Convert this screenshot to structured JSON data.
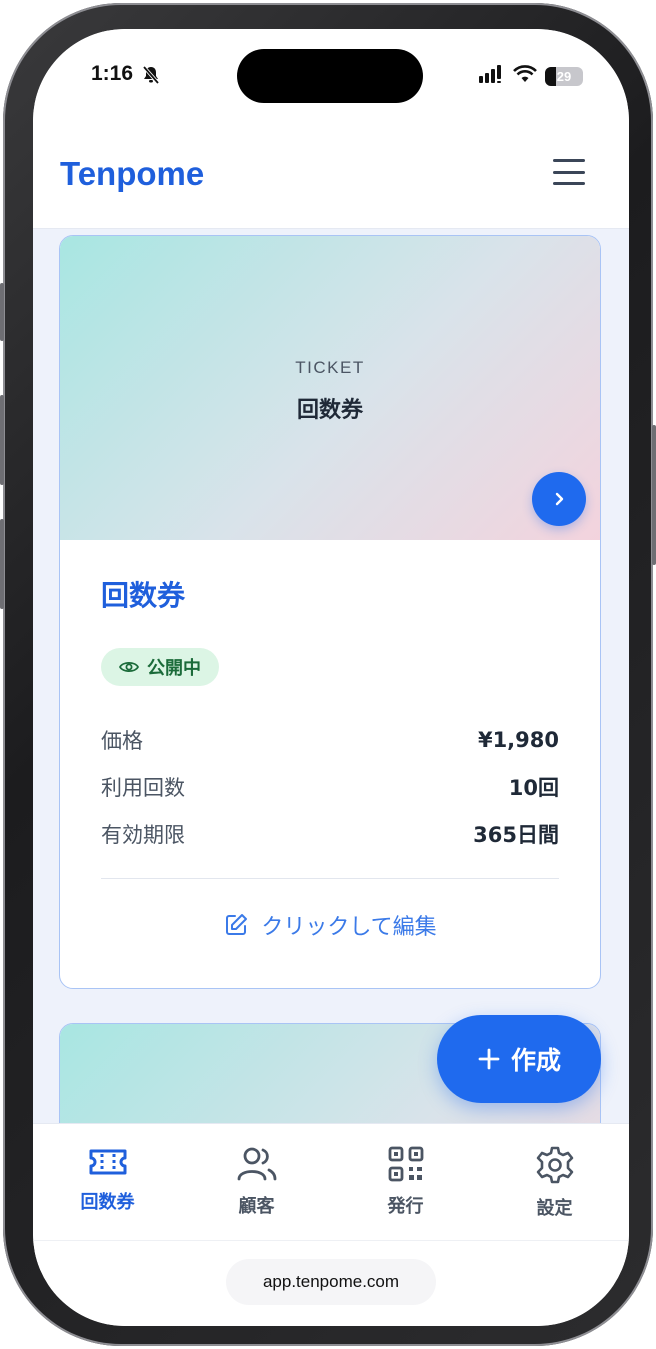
{
  "status_bar": {
    "time": "1:16",
    "battery": "29"
  },
  "app": {
    "brand": "Tenpome"
  },
  "ticket_card": {
    "hero_kicker": "TICKET",
    "hero_title": "回数券",
    "title": "回数券",
    "status_badge": "公開中",
    "rows": [
      {
        "label": "価格",
        "value": "¥1,980"
      },
      {
        "label": "利用回数",
        "value": "10回"
      },
      {
        "label": "有効期限",
        "value": "365日間"
      }
    ],
    "edit_label": "クリックして編集"
  },
  "fab": {
    "label": "作成"
  },
  "bottom_nav": {
    "items": [
      {
        "label": "回数券",
        "icon": "ticket-icon",
        "active": true
      },
      {
        "label": "顧客",
        "icon": "users-icon",
        "active": false
      },
      {
        "label": "発行",
        "icon": "qr-code-icon",
        "active": false
      },
      {
        "label": "設定",
        "icon": "gear-icon",
        "active": false
      }
    ]
  },
  "browser": {
    "url": "app.tenpome.com"
  },
  "colors": {
    "accent": "#1f6aee",
    "brand": "#1f5fdc",
    "badge_bg": "#dcf5e5",
    "badge_text": "#1b6b3a"
  }
}
